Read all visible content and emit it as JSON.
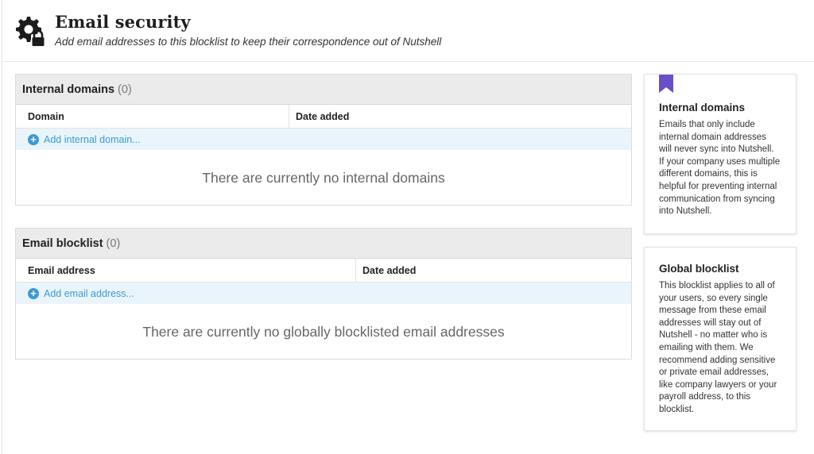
{
  "header": {
    "title": "Email security",
    "subtitle": "Add email addresses to this blocklist to keep their correspondence out of Nutshell",
    "icon": "gear-lock-icon"
  },
  "internal_domains": {
    "title": "Internal domains",
    "count": "(0)",
    "columns": [
      "Domain",
      "Date added"
    ],
    "add_label": "Add internal domain...",
    "empty_message": "There are currently no internal domains",
    "rows": []
  },
  "email_blocklist": {
    "title": "Email blocklist",
    "count": "(0)",
    "columns": [
      "Email address",
      "Date added"
    ],
    "add_label": "Add email address...",
    "empty_message": "There are currently no globally blocklisted email addresses",
    "rows": []
  },
  "sidebar": {
    "internal_card": {
      "title": "Internal domains",
      "body": "Emails that only include internal domain addresses will never sync into Nutshell. If your company uses multiple different domains, this is helpful for preventing internal communication from syncing into Nutshell."
    },
    "global_card": {
      "title": "Global blocklist",
      "body": "This blocklist applies to all of your users, so every single message from these email addresses will stay out of Nutshell - no matter who is emailing with them. We recommend adding sensitive or private email addresses, like company lawyers or your payroll address, to this blocklist."
    }
  },
  "colors": {
    "accent_link": "#3b9ad4",
    "bookmark": "#6b4fc8",
    "panel_header_bg": "#ebebeb",
    "add_row_bg": "#eaf5fb"
  }
}
